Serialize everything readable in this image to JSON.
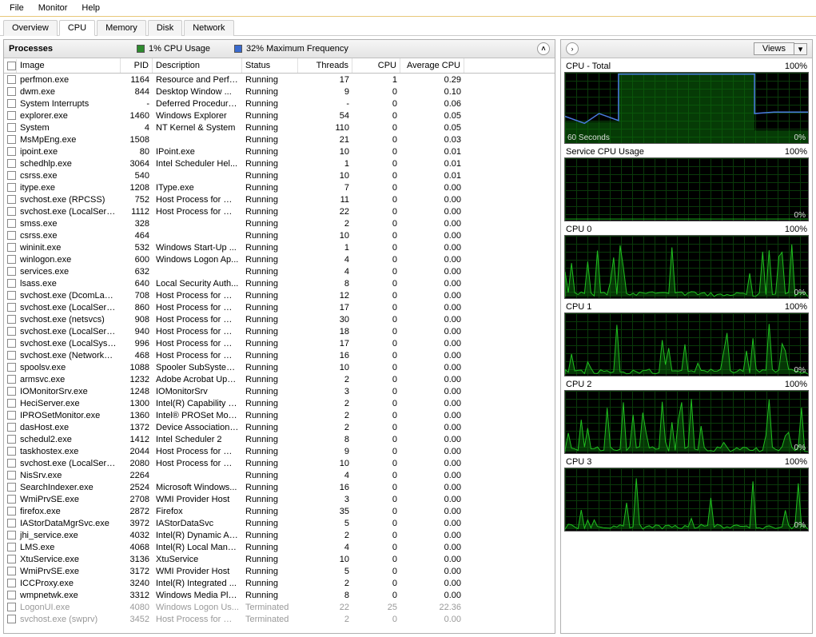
{
  "menu": [
    "File",
    "Monitor",
    "Help"
  ],
  "tabs": [
    {
      "label": "Overview",
      "active": false
    },
    {
      "label": "CPU",
      "active": true
    },
    {
      "label": "Memory",
      "active": false
    },
    {
      "label": "Disk",
      "active": false
    },
    {
      "label": "Network",
      "active": false
    }
  ],
  "section": {
    "title": "Processes",
    "cpu_usage": "1% CPU Usage",
    "max_freq": "32% Maximum Frequency"
  },
  "columns": [
    "",
    "Image",
    "PID",
    "Description",
    "Status",
    "Threads",
    "CPU",
    "Average CPU"
  ],
  "rows": [
    {
      "image": "perfmon.exe",
      "pid": "1164",
      "desc": "Resource and Perfo...",
      "status": "Running",
      "threads": "17",
      "cpu": "1",
      "avg": "0.29",
      "term": false
    },
    {
      "image": "dwm.exe",
      "pid": "844",
      "desc": "Desktop Window ...",
      "status": "Running",
      "threads": "9",
      "cpu": "0",
      "avg": "0.10",
      "term": false
    },
    {
      "image": "System Interrupts",
      "pid": "-",
      "desc": "Deferred Procedure...",
      "status": "Running",
      "threads": "-",
      "cpu": "0",
      "avg": "0.06",
      "term": false
    },
    {
      "image": "explorer.exe",
      "pid": "1460",
      "desc": "Windows Explorer",
      "status": "Running",
      "threads": "54",
      "cpu": "0",
      "avg": "0.05",
      "term": false
    },
    {
      "image": "System",
      "pid": "4",
      "desc": "NT Kernel & System",
      "status": "Running",
      "threads": "110",
      "cpu": "0",
      "avg": "0.05",
      "term": false
    },
    {
      "image": "MsMpEng.exe",
      "pid": "1508",
      "desc": "",
      "status": "Running",
      "threads": "21",
      "cpu": "0",
      "avg": "0.03",
      "term": false
    },
    {
      "image": "ipoint.exe",
      "pid": "80",
      "desc": "IPoint.exe",
      "status": "Running",
      "threads": "10",
      "cpu": "0",
      "avg": "0.01",
      "term": false
    },
    {
      "image": "schedhlp.exe",
      "pid": "3064",
      "desc": "Intel Scheduler Hel...",
      "status": "Running",
      "threads": "1",
      "cpu": "0",
      "avg": "0.01",
      "term": false
    },
    {
      "image": "csrss.exe",
      "pid": "540",
      "desc": "",
      "status": "Running",
      "threads": "10",
      "cpu": "0",
      "avg": "0.01",
      "term": false
    },
    {
      "image": "itype.exe",
      "pid": "1208",
      "desc": "IType.exe",
      "status": "Running",
      "threads": "7",
      "cpu": "0",
      "avg": "0.00",
      "term": false
    },
    {
      "image": "svchost.exe (RPCSS)",
      "pid": "752",
      "desc": "Host Process for Wi...",
      "status": "Running",
      "threads": "11",
      "cpu": "0",
      "avg": "0.00",
      "term": false
    },
    {
      "image": "svchost.exe (LocalServiceNo...",
      "pid": "1112",
      "desc": "Host Process for Wi...",
      "status": "Running",
      "threads": "22",
      "cpu": "0",
      "avg": "0.00",
      "term": false
    },
    {
      "image": "smss.exe",
      "pid": "328",
      "desc": "",
      "status": "Running",
      "threads": "2",
      "cpu": "0",
      "avg": "0.00",
      "term": false
    },
    {
      "image": "csrss.exe",
      "pid": "464",
      "desc": "",
      "status": "Running",
      "threads": "10",
      "cpu": "0",
      "avg": "0.00",
      "term": false
    },
    {
      "image": "wininit.exe",
      "pid": "532",
      "desc": "Windows Start-Up ...",
      "status": "Running",
      "threads": "1",
      "cpu": "0",
      "avg": "0.00",
      "term": false
    },
    {
      "image": "winlogon.exe",
      "pid": "600",
      "desc": "Windows Logon Ap...",
      "status": "Running",
      "threads": "4",
      "cpu": "0",
      "avg": "0.00",
      "term": false
    },
    {
      "image": "services.exe",
      "pid": "632",
      "desc": "",
      "status": "Running",
      "threads": "4",
      "cpu": "0",
      "avg": "0.00",
      "term": false
    },
    {
      "image": "lsass.exe",
      "pid": "640",
      "desc": "Local Security Auth...",
      "status": "Running",
      "threads": "8",
      "cpu": "0",
      "avg": "0.00",
      "term": false
    },
    {
      "image": "svchost.exe (DcomLaunch)",
      "pid": "708",
      "desc": "Host Process for Wi...",
      "status": "Running",
      "threads": "12",
      "cpu": "0",
      "avg": "0.00",
      "term": false
    },
    {
      "image": "svchost.exe (LocalServiceNet...",
      "pid": "860",
      "desc": "Host Process for Wi...",
      "status": "Running",
      "threads": "17",
      "cpu": "0",
      "avg": "0.00",
      "term": false
    },
    {
      "image": "svchost.exe (netsvcs)",
      "pid": "908",
      "desc": "Host Process for Wi...",
      "status": "Running",
      "threads": "30",
      "cpu": "0",
      "avg": "0.00",
      "term": false
    },
    {
      "image": "svchost.exe (LocalService)",
      "pid": "940",
      "desc": "Host Process for Wi...",
      "status": "Running",
      "threads": "18",
      "cpu": "0",
      "avg": "0.00",
      "term": false
    },
    {
      "image": "svchost.exe (LocalSystemNet...",
      "pid": "996",
      "desc": "Host Process for Wi...",
      "status": "Running",
      "threads": "17",
      "cpu": "0",
      "avg": "0.00",
      "term": false
    },
    {
      "image": "svchost.exe (NetworkService)",
      "pid": "468",
      "desc": "Host Process for Wi...",
      "status": "Running",
      "threads": "16",
      "cpu": "0",
      "avg": "0.00",
      "term": false
    },
    {
      "image": "spoolsv.exe",
      "pid": "1088",
      "desc": "Spooler SubSystem ...",
      "status": "Running",
      "threads": "10",
      "cpu": "0",
      "avg": "0.00",
      "term": false
    },
    {
      "image": "armsvc.exe",
      "pid": "1232",
      "desc": "Adobe Acrobat Upd...",
      "status": "Running",
      "threads": "2",
      "cpu": "0",
      "avg": "0.00",
      "term": false
    },
    {
      "image": "IOMonitorSrv.exe",
      "pid": "1248",
      "desc": "IOMonitorSrv",
      "status": "Running",
      "threads": "3",
      "cpu": "0",
      "avg": "0.00",
      "term": false
    },
    {
      "image": "HeciServer.exe",
      "pid": "1300",
      "desc": "Intel(R) Capability Li...",
      "status": "Running",
      "threads": "2",
      "cpu": "0",
      "avg": "0.00",
      "term": false
    },
    {
      "image": "IPROSetMonitor.exe",
      "pid": "1360",
      "desc": "Intel® PROSet Mon...",
      "status": "Running",
      "threads": "2",
      "cpu": "0",
      "avg": "0.00",
      "term": false
    },
    {
      "image": "dasHost.exe",
      "pid": "1372",
      "desc": "Device Association ...",
      "status": "Running",
      "threads": "2",
      "cpu": "0",
      "avg": "0.00",
      "term": false
    },
    {
      "image": "schedul2.exe",
      "pid": "1412",
      "desc": "Intel Scheduler 2",
      "status": "Running",
      "threads": "8",
      "cpu": "0",
      "avg": "0.00",
      "term": false
    },
    {
      "image": "taskhostex.exe",
      "pid": "2044",
      "desc": "Host Process for Wi...",
      "status": "Running",
      "threads": "9",
      "cpu": "0",
      "avg": "0.00",
      "term": false
    },
    {
      "image": "svchost.exe (LocalServiceAn...",
      "pid": "2080",
      "desc": "Host Process for Wi...",
      "status": "Running",
      "threads": "10",
      "cpu": "0",
      "avg": "0.00",
      "term": false
    },
    {
      "image": "NisSrv.exe",
      "pid": "2264",
      "desc": "",
      "status": "Running",
      "threads": "4",
      "cpu": "0",
      "avg": "0.00",
      "term": false
    },
    {
      "image": "SearchIndexer.exe",
      "pid": "2524",
      "desc": "Microsoft Windows...",
      "status": "Running",
      "threads": "16",
      "cpu": "0",
      "avg": "0.00",
      "term": false
    },
    {
      "image": "WmiPrvSE.exe",
      "pid": "2708",
      "desc": "WMI Provider Host",
      "status": "Running",
      "threads": "3",
      "cpu": "0",
      "avg": "0.00",
      "term": false
    },
    {
      "image": "firefox.exe",
      "pid": "2872",
      "desc": "Firefox",
      "status": "Running",
      "threads": "35",
      "cpu": "0",
      "avg": "0.00",
      "term": false
    },
    {
      "image": "IAStorDataMgrSvc.exe",
      "pid": "3972",
      "desc": "IAStorDataSvc",
      "status": "Running",
      "threads": "5",
      "cpu": "0",
      "avg": "0.00",
      "term": false
    },
    {
      "image": "jhi_service.exe",
      "pid": "4032",
      "desc": "Intel(R) Dynamic Ap...",
      "status": "Running",
      "threads": "2",
      "cpu": "0",
      "avg": "0.00",
      "term": false
    },
    {
      "image": "LMS.exe",
      "pid": "4068",
      "desc": "Intel(R) Local Mana...",
      "status": "Running",
      "threads": "4",
      "cpu": "0",
      "avg": "0.00",
      "term": false
    },
    {
      "image": "XtuService.exe",
      "pid": "3136",
      "desc": "XtuService",
      "status": "Running",
      "threads": "10",
      "cpu": "0",
      "avg": "0.00",
      "term": false
    },
    {
      "image": "WmiPrvSE.exe",
      "pid": "3172",
      "desc": "WMI Provider Host",
      "status": "Running",
      "threads": "5",
      "cpu": "0",
      "avg": "0.00",
      "term": false
    },
    {
      "image": "ICCProxy.exe",
      "pid": "3240",
      "desc": "Intel(R) Integrated ...",
      "status": "Running",
      "threads": "2",
      "cpu": "0",
      "avg": "0.00",
      "term": false
    },
    {
      "image": "wmpnetwk.exe",
      "pid": "3312",
      "desc": "Windows Media Pla...",
      "status": "Running",
      "threads": "8",
      "cpu": "0",
      "avg": "0.00",
      "term": false
    },
    {
      "image": "LogonUI.exe",
      "pid": "4080",
      "desc": "Windows Logon Us...",
      "status": "Terminated",
      "threads": "22",
      "cpu": "25",
      "avg": "22.36",
      "term": true
    },
    {
      "image": "svchost.exe (swprv)",
      "pid": "3452",
      "desc": "Host Process for Wi...",
      "status": "Terminated",
      "threads": "2",
      "cpu": "0",
      "avg": "0.00",
      "term": true
    }
  ],
  "right": {
    "views_label": "Views",
    "charts": [
      {
        "label": "CPU - Total",
        "max": "100%",
        "bottom_left": "60 Seconds",
        "bottom_right": "0%",
        "type": "total"
      },
      {
        "label": "Service CPU Usage",
        "max": "100%",
        "bottom_left": "",
        "bottom_right": "0%",
        "type": "flat"
      },
      {
        "label": "CPU 0",
        "max": "100%",
        "bottom_left": "",
        "bottom_right": "0%",
        "type": "spike"
      },
      {
        "label": "CPU 1",
        "max": "100%",
        "bottom_left": "",
        "bottom_right": "0%",
        "type": "spike"
      },
      {
        "label": "CPU 2",
        "max": "100%",
        "bottom_left": "",
        "bottom_right": "0%",
        "type": "spike"
      },
      {
        "label": "CPU 3",
        "max": "100%",
        "bottom_left": "",
        "bottom_right": "0%",
        "type": "spike"
      }
    ]
  }
}
